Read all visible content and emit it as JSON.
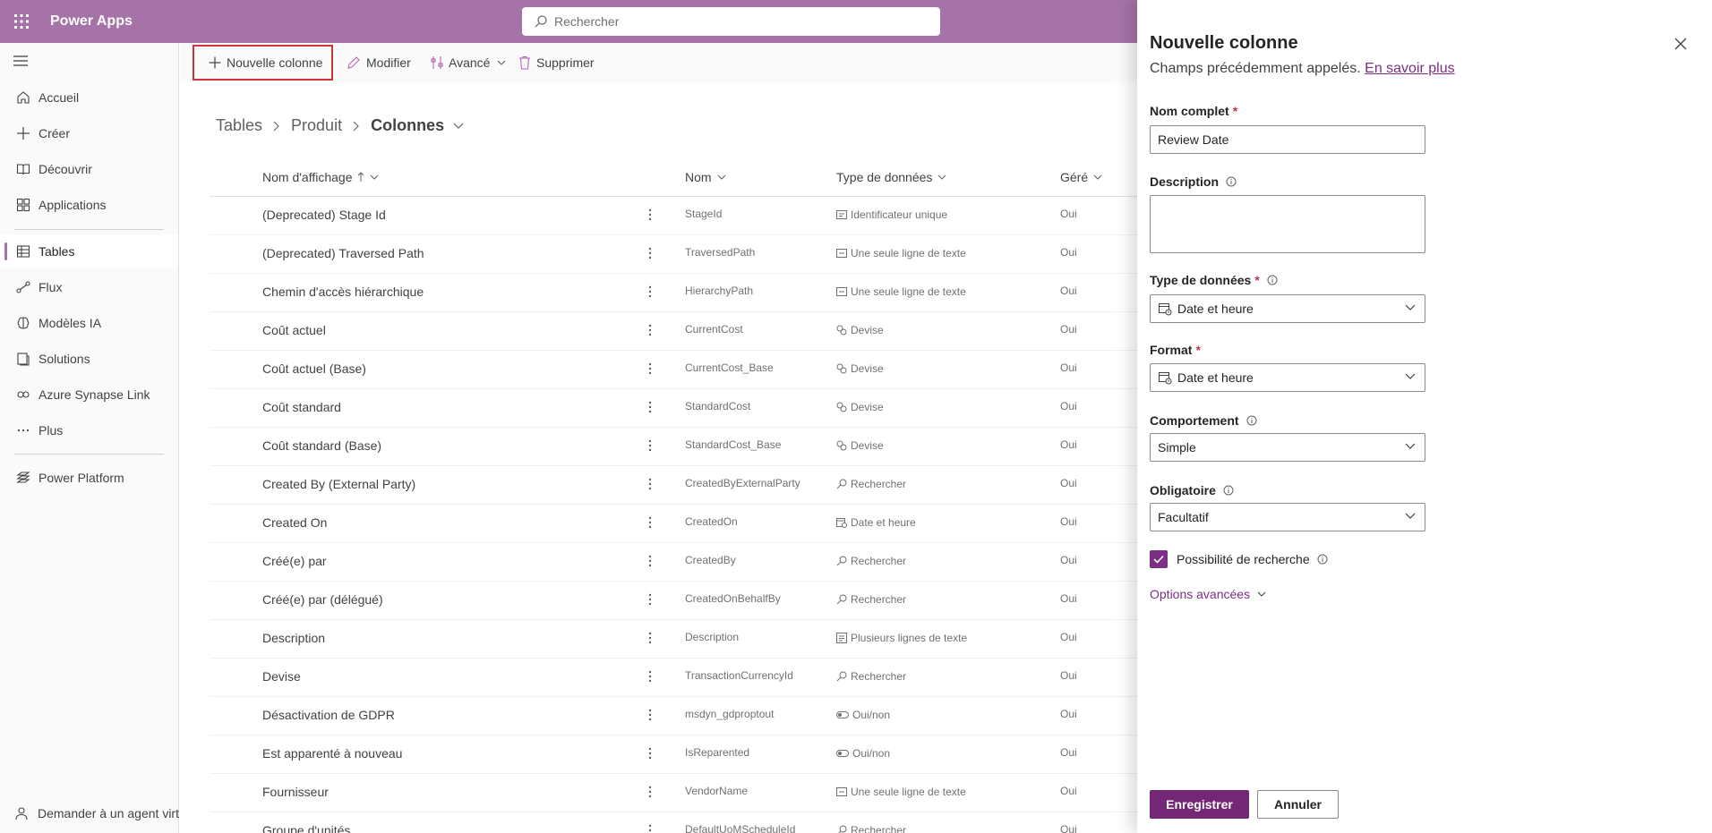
{
  "app": {
    "title": "Power Apps"
  },
  "search": {
    "placeholder": "Rechercher"
  },
  "nav": {
    "items": [
      {
        "label": "Accueil",
        "icon": "home-icon"
      },
      {
        "label": "Créer",
        "icon": "plus-icon"
      },
      {
        "label": "Découvrir",
        "icon": "book-icon"
      },
      {
        "label": "Applications",
        "icon": "apps-icon"
      },
      {
        "label": "Tables",
        "icon": "table-icon",
        "active": true
      },
      {
        "label": "Flux",
        "icon": "flow-icon"
      },
      {
        "label": "Modèles IA",
        "icon": "brain-icon"
      },
      {
        "label": "Solutions",
        "icon": "solutions-icon"
      },
      {
        "label": "Azure Synapse Link",
        "icon": "synapse-icon"
      },
      {
        "label": "Plus",
        "icon": "more-icon"
      },
      {
        "label": "Power Platform",
        "icon": "power-platform-icon"
      }
    ],
    "assistant": "Demander à un agent virtuel"
  },
  "commands": {
    "new_column": "Nouvelle colonne",
    "edit": "Modifier",
    "advanced": "Avancé",
    "delete": "Supprimer"
  },
  "breadcrumb": {
    "tables": "Tables",
    "product": "Produit",
    "columns": "Colonnes"
  },
  "table": {
    "headers": {
      "display": "Nom d'affichage",
      "name": "Nom",
      "type": "Type de données",
      "managed": "Géré"
    },
    "rows": [
      {
        "display": "(Deprecated) Stage Id",
        "name": "StageId",
        "type": "Identificateur unique",
        "type_icon": "id-icon",
        "managed": "Oui"
      },
      {
        "display": "(Deprecated) Traversed Path",
        "name": "TraversedPath",
        "type": "Une seule ligne de texte",
        "type_icon": "text-icon",
        "managed": "Oui"
      },
      {
        "display": "Chemin d'accès hiérarchique",
        "name": "HierarchyPath",
        "type": "Une seule ligne de texte",
        "type_icon": "text-icon",
        "managed": "Oui"
      },
      {
        "display": "Coût actuel",
        "name": "CurrentCost",
        "type": "Devise",
        "type_icon": "currency-icon",
        "managed": "Oui"
      },
      {
        "display": "Coût actuel (Base)",
        "name": "CurrentCost_Base",
        "type": "Devise",
        "type_icon": "currency-icon",
        "managed": "Oui"
      },
      {
        "display": "Coût standard",
        "name": "StandardCost",
        "type": "Devise",
        "type_icon": "currency-icon",
        "managed": "Oui"
      },
      {
        "display": "Coût standard (Base)",
        "name": "StandardCost_Base",
        "type": "Devise",
        "type_icon": "currency-icon",
        "managed": "Oui"
      },
      {
        "display": "Created By (External Party)",
        "name": "CreatedByExternalParty",
        "type": "Rechercher",
        "type_icon": "lookup-icon",
        "managed": "Oui"
      },
      {
        "display": "Created On",
        "name": "CreatedOn",
        "type": "Date et heure",
        "type_icon": "calendar-icon",
        "managed": "Oui"
      },
      {
        "display": "Créé(e) par",
        "name": "CreatedBy",
        "type": "Rechercher",
        "type_icon": "lookup-icon",
        "managed": "Oui"
      },
      {
        "display": "Créé(e) par (délégué)",
        "name": "CreatedOnBehalfBy",
        "type": "Rechercher",
        "type_icon": "lookup-icon",
        "managed": "Oui"
      },
      {
        "display": "Description",
        "name": "Description",
        "type": "Plusieurs lignes de texte",
        "type_icon": "multiline-icon",
        "managed": "Oui"
      },
      {
        "display": "Devise",
        "name": "TransactionCurrencyId",
        "type": "Rechercher",
        "type_icon": "lookup-icon",
        "managed": "Oui"
      },
      {
        "display": "Désactivation de GDPR",
        "name": "msdyn_gdproptout",
        "type": "Oui/non",
        "type_icon": "toggle-icon",
        "managed": "Oui"
      },
      {
        "display": "Est apparenté à nouveau",
        "name": "IsReparented",
        "type": "Oui/non",
        "type_icon": "toggle-icon",
        "managed": "Oui"
      },
      {
        "display": "Fournisseur",
        "name": "VendorName",
        "type": "Une seule ligne de texte",
        "type_icon": "text-icon",
        "managed": "Oui"
      },
      {
        "display": "Groupe d'unités",
        "name": "DefaultUoMScheduleId",
        "type": "Rechercher",
        "type_icon": "lookup-icon",
        "managed": "Oui"
      }
    ]
  },
  "panel": {
    "title": "Nouvelle colonne",
    "subtitle": "Champs précédemment appelés.",
    "learn_more": "En savoir plus",
    "full_name_label": "Nom complet",
    "full_name_value": "Review Date",
    "description_label": "Description",
    "data_type_label": "Type de données",
    "data_type_value": "Date et heure",
    "format_label": "Format",
    "format_value": "Date et heure",
    "behavior_label": "Comportement",
    "behavior_value": "Simple",
    "required_label": "Obligatoire",
    "required_value": "Facultatif",
    "searchable_label": "Possibilité de recherche",
    "searchable_checked": true,
    "advanced_options": "Options avancées",
    "save": "Enregistrer",
    "cancel": "Annuler",
    "required_marker": "*"
  },
  "colors": {
    "brand": "#a673a8",
    "accent": "#742774",
    "highlight_border": "#d13438"
  }
}
